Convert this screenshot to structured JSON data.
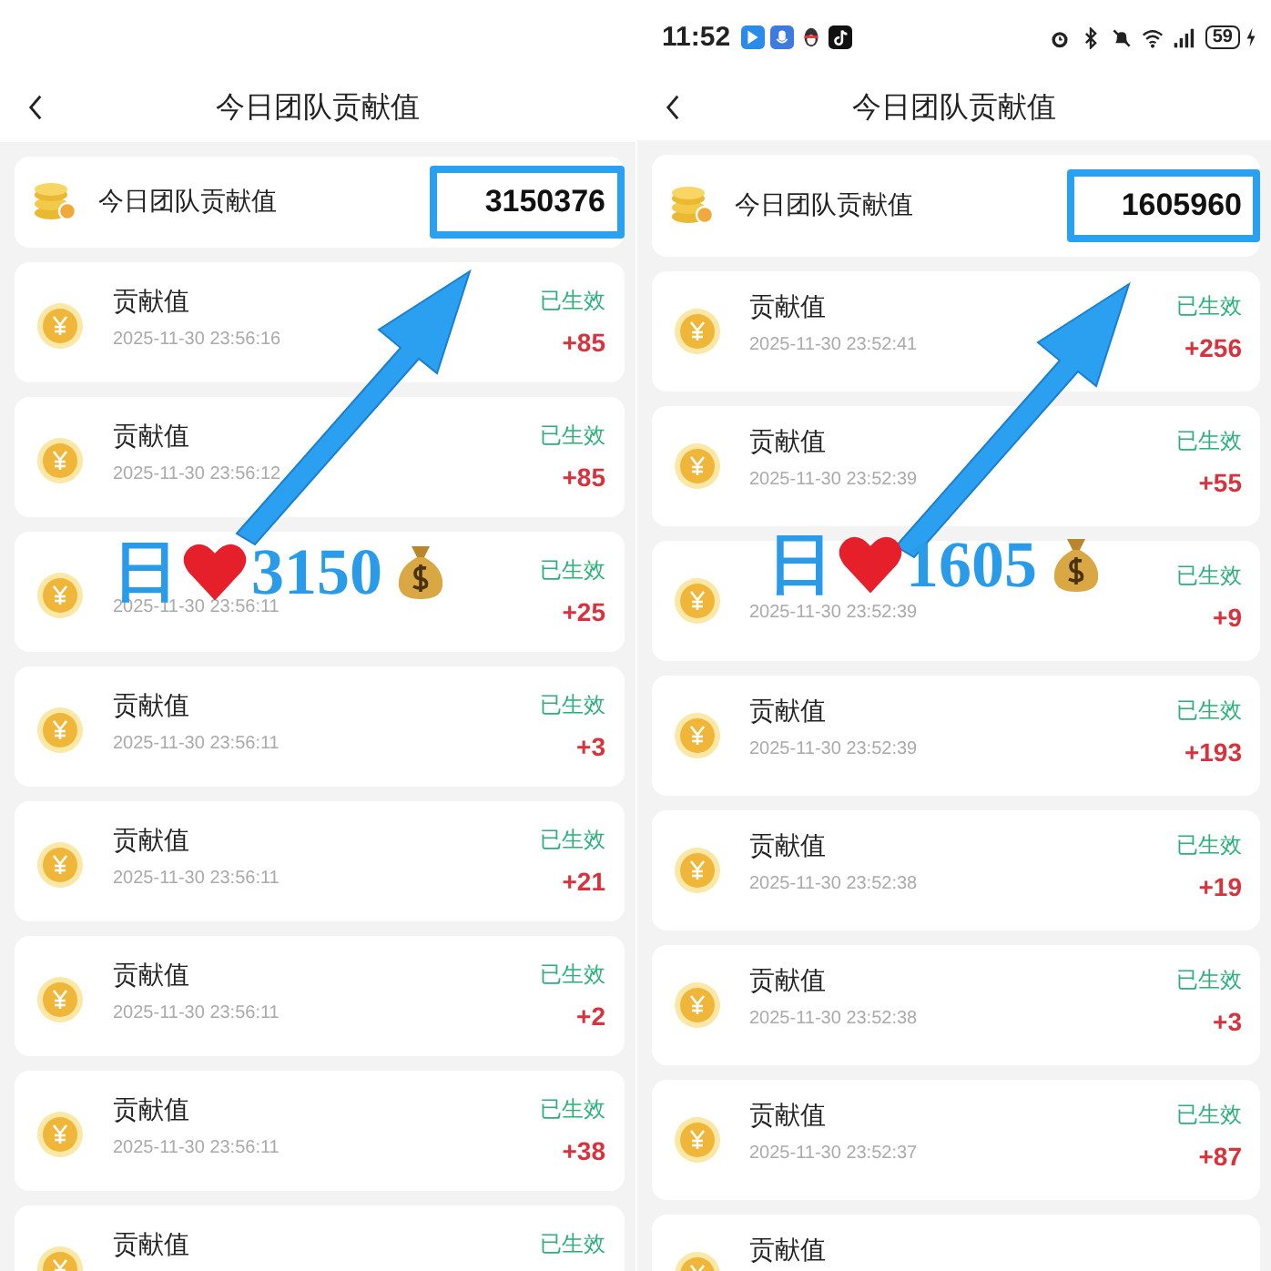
{
  "panels": [
    {
      "title": "今日团队贡献值",
      "summary": {
        "label": "今日团队贡献值",
        "total": "3150376",
        "highlighted": true
      },
      "overlay": {
        "prefix": "日",
        "number": "3150"
      },
      "records": [
        {
          "title": "贡献值",
          "time": "2025-11-30 23:56:16",
          "status": "已生效",
          "amount": "+85"
        },
        {
          "title": "贡献值",
          "time": "2025-11-30 23:56:12",
          "status": "已生效",
          "amount": "+85"
        },
        {
          "time": "2025-11-30 23:56:11",
          "status": "已生效",
          "amount": "+25"
        },
        {
          "title": "贡献值",
          "time": "2025-11-30 23:56:11",
          "status": "已生效",
          "amount": "+3"
        },
        {
          "title": "贡献值",
          "time": "2025-11-30 23:56:11",
          "status": "已生效",
          "amount": "+21"
        },
        {
          "title": "贡献值",
          "time": "2025-11-30 23:56:11",
          "status": "已生效",
          "amount": "+2"
        },
        {
          "title": "贡献值",
          "time": "2025-11-30 23:56:11",
          "status": "已生效",
          "amount": "+38"
        },
        {
          "title": "贡献值",
          "status": "已生效"
        }
      ]
    },
    {
      "status_bar": {
        "time": "11:52",
        "battery": "59"
      },
      "title": "今日团队贡献值",
      "summary": {
        "label": "今日团队贡献值",
        "total": "1605960",
        "highlighted": true
      },
      "overlay": {
        "prefix": "日",
        "number": "1605"
      },
      "records": [
        {
          "title": "贡献值",
          "time": "2025-11-30 23:52:41",
          "status": "已生效",
          "amount": "+256"
        },
        {
          "title": "贡献值",
          "time": "2025-11-30 23:52:39",
          "status": "已生效",
          "amount": "+55"
        },
        {
          "time": "2025-11-30 23:52:39",
          "status": "已生效",
          "amount": "+9"
        },
        {
          "title": "贡献值",
          "time": "2025-11-30 23:52:39",
          "status": "已生效",
          "amount": "+193"
        },
        {
          "title": "贡献值",
          "time": "2025-11-30 23:52:38",
          "status": "已生效",
          "amount": "+19"
        },
        {
          "title": "贡献值",
          "time": "2025-11-30 23:52:38",
          "status": "已生效",
          "amount": "+3"
        },
        {
          "title": "贡献值",
          "time": "2025-11-30 23:52:37",
          "status": "已生效",
          "amount": "+87"
        },
        {
          "title": "贡献值"
        }
      ]
    }
  ]
}
